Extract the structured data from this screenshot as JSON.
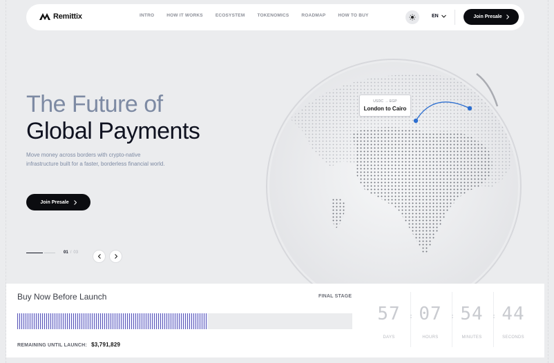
{
  "brand": {
    "name": "Remittix"
  },
  "nav": {
    "items": [
      "INTRO",
      "HOW IT WORKS",
      "ECOSYSTEM",
      "TOKENOMICS",
      "ROADMAP",
      "HOW TO BUY"
    ],
    "lang": "EN",
    "cta": "Join Presale",
    "theme_icon": "sun-icon"
  },
  "hero": {
    "title_line1": "The Future of",
    "title_line2": "Global Payments",
    "subtitle": "Move money across borders with crypto-native infrastructure built for a faster, borderless financial world.",
    "cta": "Join Presale",
    "slide_current": "01",
    "slide_sep": "/",
    "slide_total": "03"
  },
  "globe": {
    "route_pair": "USDC → EGP",
    "route_label": "London to Cairo"
  },
  "presale": {
    "title": "Buy Now Before Launch",
    "stage": "FINAL STAGE",
    "progress": 0.57,
    "remaining_label": "REMAINING UNTIL LAUNCH:",
    "remaining_value": "$3,791,829",
    "countdown": [
      {
        "value": "57",
        "label": "DAYS"
      },
      {
        "value": "07",
        "label": "HOURS"
      },
      {
        "value": "54",
        "label": "MINUTES"
      },
      {
        "value": "44",
        "label": "SECONDS"
      }
    ]
  },
  "colors": {
    "accent": "#2d6fd0",
    "progress": "#5a55b5",
    "dark": "#0b0c10"
  }
}
